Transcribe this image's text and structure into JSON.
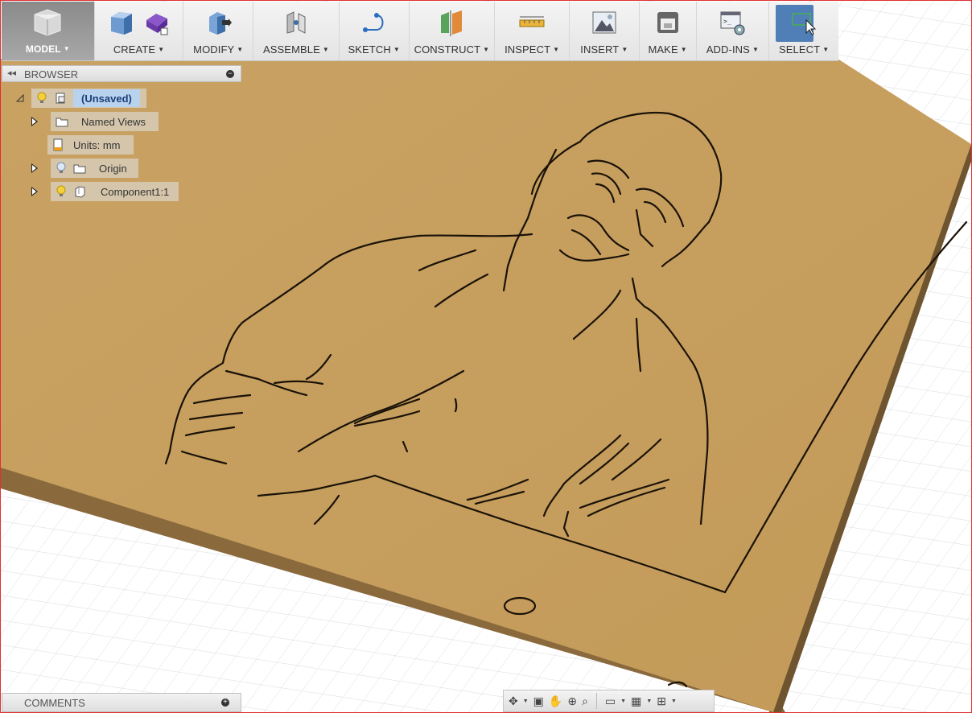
{
  "toolbar": {
    "model": "MODEL",
    "create": "CREATE",
    "modify": "MODIFY",
    "assemble": "ASSEMBLE",
    "sketch": "SKETCH",
    "construct": "CONSTRUCT",
    "inspect": "INSPECT",
    "insert": "INSERT",
    "make": "MAKE",
    "addins": "ADD-INS",
    "select": "SELECT"
  },
  "browser": {
    "title": "BROWSER",
    "items": [
      {
        "label": "(Unsaved)"
      },
      {
        "label": "Named Views"
      },
      {
        "label": "Units: mm"
      },
      {
        "label": "Origin"
      },
      {
        "label": "Component1:1"
      }
    ]
  },
  "comments": {
    "title": "COMMENTS"
  },
  "colors": {
    "plate_top": "#c7a061",
    "plate_side": "#8a6a3d",
    "engraving": "#1a1208",
    "select_active": "#4f7fb6"
  }
}
